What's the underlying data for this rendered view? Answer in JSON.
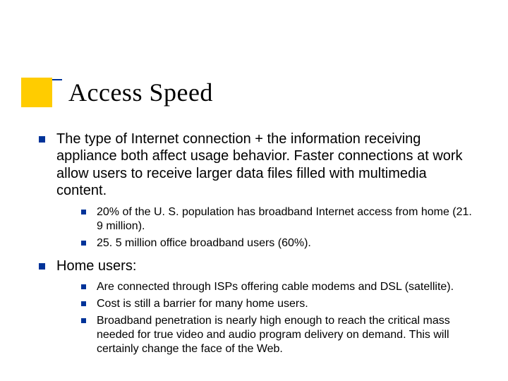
{
  "accent": {
    "block_color": "#ffcc00",
    "line_color": "#003399"
  },
  "title": "Access Speed",
  "bullets": [
    {
      "text": "The type of Internet connection + the information receiving appliance both affect usage behavior. Faster connections at work allow users to receive larger data files filled with multimedia content.",
      "children": [
        "20% of the U. S. population has broadband Internet access from home (21. 9 million).",
        "25. 5 million office broadband users (60%)."
      ]
    },
    {
      "text": "Home users:",
      "children": [
        "Are connected through ISPs offering cable modems and DSL (satellite).",
        "Cost is still a barrier for many home users.",
        "Broadband penetration is nearly high enough to reach the critical mass needed for true video and audio program delivery on demand. This will certainly change the face of the Web."
      ]
    }
  ]
}
